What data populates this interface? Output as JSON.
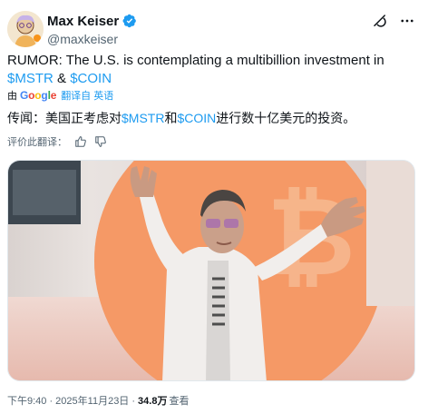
{
  "author": {
    "display_name": "Max Keiser",
    "handle": "@maxkeiser"
  },
  "icons": {
    "verified": "verified-badge-icon",
    "grok": "grok-icon",
    "more": "more-options-icon",
    "like": "thumbs-up-icon",
    "dislike": "thumbs-down-icon"
  },
  "tweet": {
    "text_prefix": "RUMOR: The U.S. is contemplating a multibillion investment in ",
    "cashtag1": "$MSTR",
    "text_mid": " & ",
    "cashtag2": "$COIN"
  },
  "translate": {
    "by": "由",
    "google": [
      "G",
      "o",
      "o",
      "g",
      "l",
      "e"
    ],
    "translated_from": "翻译自 英语"
  },
  "translation": {
    "prefix": "传闻：美国正考虑对",
    "cashtag1": "$MSTR",
    "mid": "和",
    "cashtag2": "$COIN",
    "suffix": "进行数十亿美元的投资。"
  },
  "rate": {
    "label": "评价此翻译："
  },
  "meta": {
    "time": "下午9:40 · 2025年11月23日 · ",
    "views": "34.8万",
    "views_label": "查看"
  },
  "colors": {
    "accent": "#1d9bf0",
    "text": "#0f1419",
    "secondary": "#536471"
  }
}
